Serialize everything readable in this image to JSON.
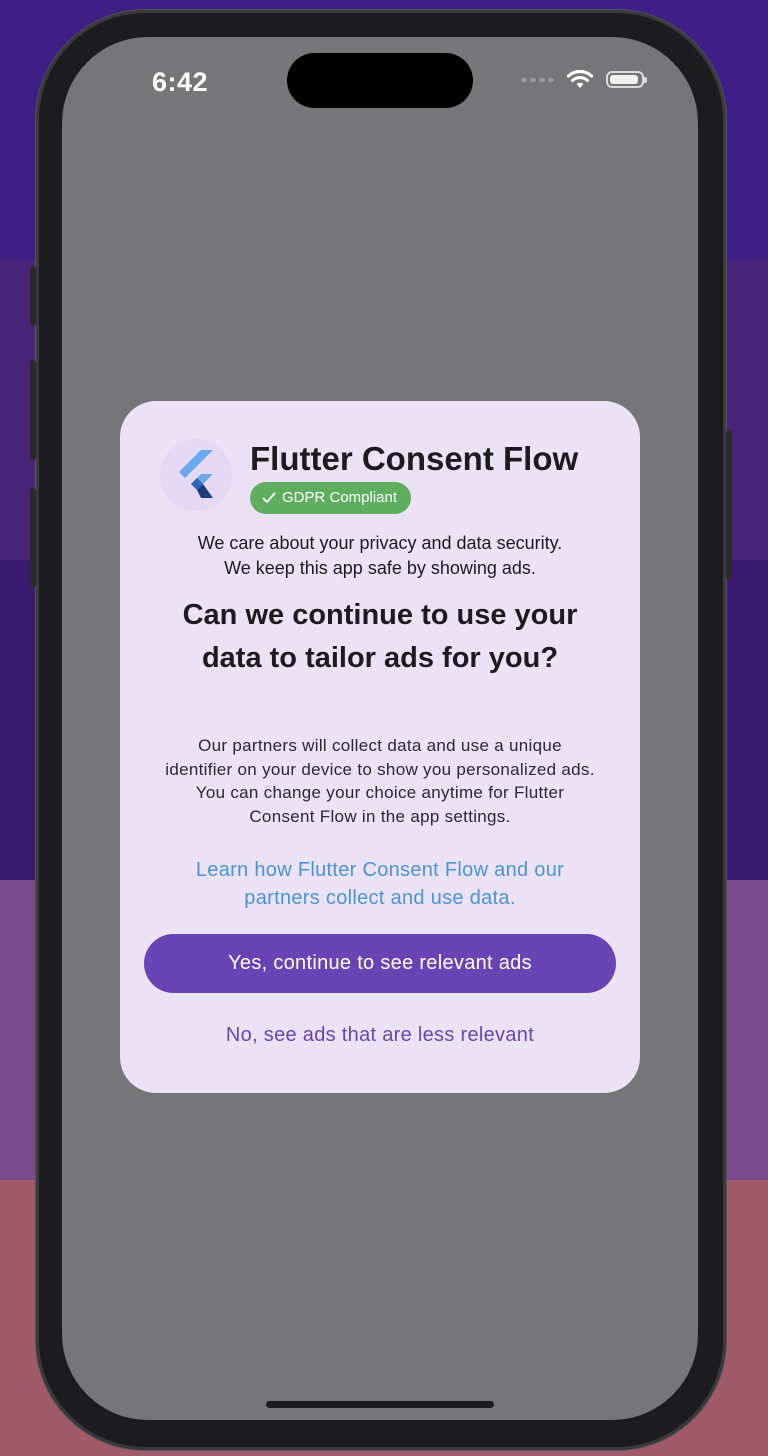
{
  "status_bar": {
    "time": "6:42"
  },
  "dialog": {
    "app_title": "Flutter Consent Flow",
    "badge_label": "GDPR Compliant",
    "intro_line1": "We care about your privacy and data security.",
    "intro_line2": "We keep this app safe by showing ads.",
    "question": "Can we continue to use your data to tailor ads for you?",
    "body": "Our partners will collect data and use a unique identifier on your device to show you personalized ads. You can change your choice anytime for Flutter Consent Flow in the app settings.",
    "learn_link": "Learn how Flutter Consent Flow and our partners collect and use data.",
    "yes_label": "Yes, continue to see relevant ads",
    "no_label": "No, see ads that are less relevant"
  },
  "icons": {
    "logo": "flutter-logo-icon",
    "badge": "check-icon",
    "signal": "cellular-signal-icon",
    "wifi": "wifi-icon",
    "battery": "battery-icon"
  },
  "colors": {
    "dialog_background": "#ebe3f5",
    "primary": "#6a44b5",
    "badge_green": "#5fae5f",
    "link_blue": "#4a93d9",
    "scrim": "#767577"
  }
}
